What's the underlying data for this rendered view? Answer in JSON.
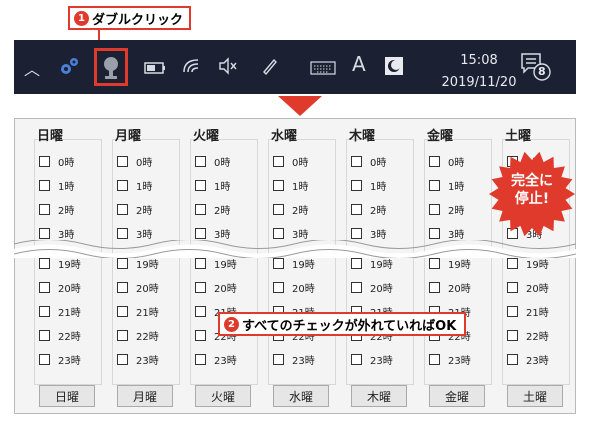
{
  "callout1": {
    "number": "1",
    "text": "ダブルクリック"
  },
  "callout2": {
    "number": "2",
    "text": "すべてのチェックが外れていればOK"
  },
  "stop_badge": {
    "line1": "完全に",
    "line2": "停止!"
  },
  "taskbar": {
    "ime": "A",
    "time": "15:08",
    "date": "2019/11/20",
    "notification_count": "8",
    "icons": [
      "chevron-up-icon",
      "gear-icon",
      "microphone-icon",
      "battery-icon",
      "wifi-icon",
      "volume-muted-icon",
      "pen-icon",
      "keyboard-icon",
      "ime-icon",
      "night-light-icon",
      "notification-icon"
    ]
  },
  "days": [
    {
      "head": "日曜",
      "button": "日曜"
    },
    {
      "head": "月曜",
      "button": "月曜"
    },
    {
      "head": "火曜",
      "button": "火曜"
    },
    {
      "head": "水曜",
      "button": "水曜"
    },
    {
      "head": "木曜",
      "button": "木曜"
    },
    {
      "head": "金曜",
      "button": "金曜"
    },
    {
      "head": "土曜",
      "button": "土曜"
    }
  ],
  "hours_top": [
    "0時",
    "1時",
    "2時",
    "3時"
  ],
  "hours_bottom": [
    "19時",
    "20時",
    "21時",
    "22時",
    "23時"
  ],
  "colors": {
    "accent": "#e03a2c",
    "taskbar": "#1b2033"
  }
}
